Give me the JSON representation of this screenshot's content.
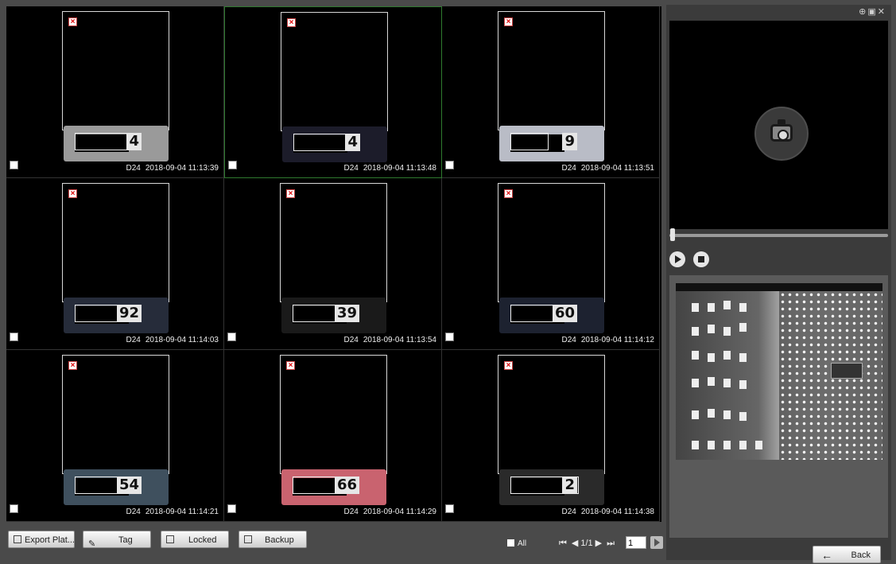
{
  "grid": {
    "cells": [
      {
        "channel": "D24",
        "time": "2018-09-04 11:13:39",
        "plate": "4",
        "plate_bg": "#9a9a9a"
      },
      {
        "channel": "D24",
        "time": "2018-09-04 11:13:48",
        "plate": "4",
        "plate_bg": "#1c1c2a"
      },
      {
        "channel": "D24",
        "time": "2018-09-04 11:13:51",
        "plate": "9",
        "plate_bg": "#b9bcc6"
      },
      {
        "channel": "D24",
        "time": "2018-09-04 11:14:03",
        "plate": "92",
        "plate_bg": "#262c3a"
      },
      {
        "channel": "D24",
        "time": "2018-09-04 11:13:54",
        "plate": "39",
        "plate_bg": "#1a1a1a"
      },
      {
        "channel": "D24",
        "time": "2018-09-04 11:14:12",
        "plate": "60",
        "plate_bg": "#1d2230"
      },
      {
        "channel": "D24",
        "time": "2018-09-04 11:14:21",
        "plate": "54",
        "plate_bg": "#3f505e"
      },
      {
        "channel": "D24",
        "time": "2018-09-04 11:14:29",
        "plate": "66",
        "plate_bg": "#c9636f"
      },
      {
        "channel": "D24",
        "time": "2018-09-04 11:14:38",
        "plate": "2",
        "plate_bg": "#2a2a2a"
      }
    ]
  },
  "toolbar": {
    "export_label": "Export Plat...",
    "tag_label": "Tag",
    "locked_label": "Locked",
    "backup_label": "Backup",
    "all_label": "All",
    "page_info": "1/1",
    "page_input": "1"
  },
  "right_panel": {
    "back_label": "Back"
  }
}
